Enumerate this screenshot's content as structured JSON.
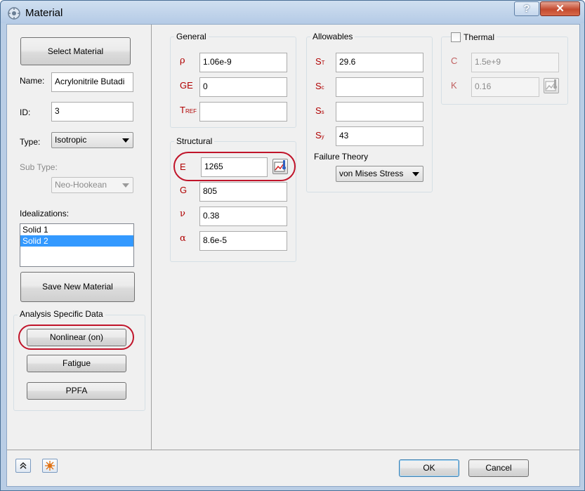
{
  "window": {
    "title": "Material",
    "help_label": "?",
    "close_label": "✕"
  },
  "left": {
    "select_material_label": "Select Material",
    "name_label": "Name:",
    "name_value": "Acrylonitrile Butadi",
    "id_label": "ID:",
    "id_value": "3",
    "type_label": "Type:",
    "type_value": "Isotropic",
    "subtype_label": "Sub Type:",
    "subtype_value": "Neo-Hookean",
    "idealizations_label": "Idealizations:",
    "idealizations": [
      "Solid 1",
      "Solid 2"
    ],
    "selected_idealization": "Solid 2",
    "save_new_material_label": "Save New Material",
    "analysis_group_title": "Analysis Specific Data",
    "nonlinear_label": "Nonlinear (on)",
    "fatigue_label": "Fatigue",
    "ppfa_label": "PPFA"
  },
  "general": {
    "title": "General",
    "rho_symbol": "ρ",
    "rho_value": "1.06e-9",
    "ge_symbol": "GE",
    "ge_value": "0",
    "tref_symbol": "T",
    "tref_sub": "REF",
    "tref_value": ""
  },
  "structural": {
    "title": "Structural",
    "e_symbol": "E",
    "e_value": "1265",
    "g_symbol": "G",
    "g_value": "805",
    "nu_symbol": "ν",
    "nu_value": "0.38",
    "alpha_symbol": "α",
    "alpha_value": "8.6e-5"
  },
  "allowables": {
    "title": "Allowables",
    "st_symbol": "S",
    "st_sub": "T",
    "st_value": "29.6",
    "sc_symbol": "S",
    "sc_sub": "c",
    "sc_value": "",
    "ss_symbol": "S",
    "ss_sub": "s",
    "ss_value": "",
    "sy_symbol": "S",
    "sy_sub": "y",
    "sy_value": "43",
    "failure_theory_label": "Failure Theory",
    "failure_theory_value": "von Mises Stress"
  },
  "thermal": {
    "title": "Thermal",
    "checked": false,
    "c_symbol": "C",
    "c_value": "1.5e+9",
    "k_symbol": "K",
    "k_value": "0.16"
  },
  "footer": {
    "ok_label": "OK",
    "cancel_label": "Cancel"
  },
  "colors": {
    "highlight_circle": "#c0142a",
    "symbol_red": "#b00000",
    "selection": "#3399ff"
  }
}
